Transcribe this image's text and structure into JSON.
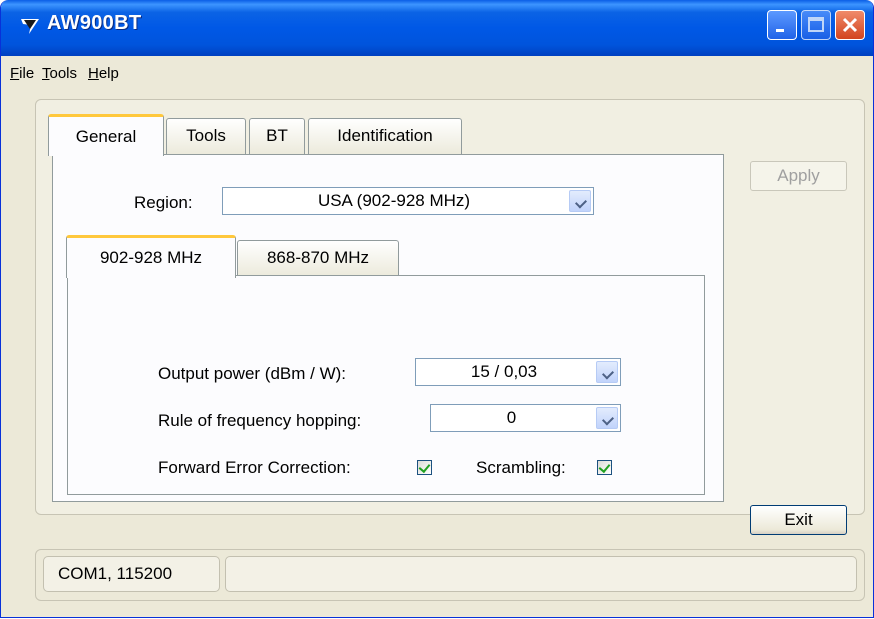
{
  "window": {
    "title": "AW900BT",
    "icon": "app-logo-icon",
    "controls": [
      "minimize-icon",
      "maximize-icon",
      "close-icon"
    ]
  },
  "menu": {
    "file": {
      "first": "F",
      "rest": "ile"
    },
    "tools": {
      "first": "T",
      "rest": "ools"
    },
    "help": {
      "first": "H",
      "rest": "elp"
    }
  },
  "tabs": {
    "general": "General",
    "tools": "Tools",
    "bt": "BT",
    "identification": "Identification"
  },
  "general": {
    "region_label": "Region:",
    "region_value": "USA (902-928 MHz)",
    "subtabs": {
      "a": "902-928 MHz",
      "b": "868-870 MHz"
    },
    "output_power_label": "Output power (dBm / W):",
    "output_power_value": "15 / 0,03",
    "hopping_label": "Rule of frequency hopping:",
    "hopping_value": "0",
    "fec_label": "Forward Error Correction:",
    "fec_checked": true,
    "scrambling_label": "Scrambling:",
    "scrambling_checked": true
  },
  "buttons": {
    "apply": "Apply",
    "exit": "Exit"
  },
  "status": {
    "connection": "COM1, 115200",
    "message": ""
  },
  "colors": {
    "titlebar": "#0058e6",
    "active_tab_accent": "#ffc83c",
    "window_bg": "#ece9d8",
    "close_button": "#d2441f"
  }
}
